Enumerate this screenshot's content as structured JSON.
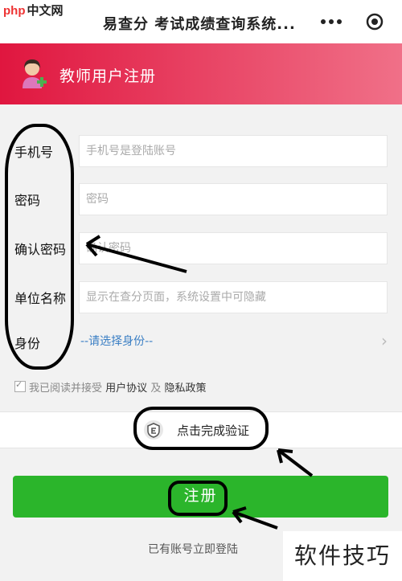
{
  "watermark_top": {
    "logo": "php",
    "text": "中文网"
  },
  "app_title": "易查分 考试成绩查询系统...",
  "icons": {
    "more": "more-dots-icon",
    "target": "target-icon",
    "avatar": "teacher-avatar-icon",
    "shield": "shield-e-icon",
    "chevron": "chevron-right-icon"
  },
  "header": {
    "title": "教师用户注册"
  },
  "form": {
    "phone": {
      "label": "手机号",
      "placeholder": "手机号是登陆账号"
    },
    "password": {
      "label": "密码",
      "placeholder": "密码"
    },
    "confirm": {
      "label": "确认密码",
      "placeholder": "确认密码"
    },
    "org": {
      "label": "单位名称",
      "placeholder": "显示在查分页面，系统设置中可隐藏"
    },
    "identity": {
      "label": "身份",
      "value": "--请选择身份--"
    }
  },
  "agreement": {
    "prefix": "我已阅读并接受",
    "terms": "用户协议",
    "and": "及",
    "privacy": "隐私政策",
    "checked": true
  },
  "verify": {
    "label": "点击完成验证"
  },
  "submit": {
    "label": "注册"
  },
  "login_link": "已有账号立即登陆",
  "watermark_bottom": "软件技巧",
  "colors": {
    "header_start": "#e0163f",
    "header_end": "#f07088",
    "submit": "#2bb52b",
    "link_blue": "#3b7fc4"
  }
}
